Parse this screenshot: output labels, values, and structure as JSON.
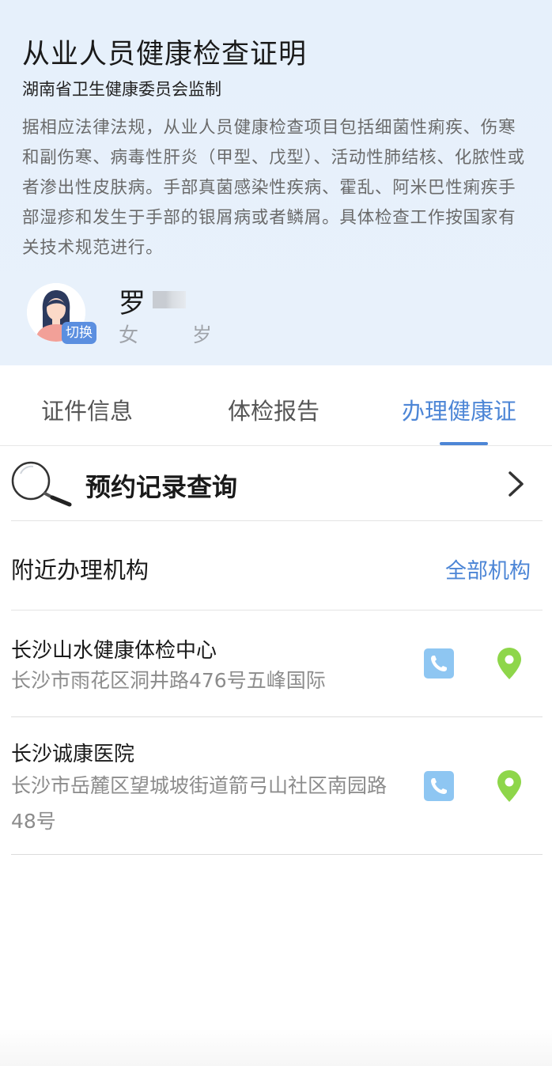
{
  "header": {
    "title": "从业人员健康检查证明",
    "supervisor": "湖南省卫生健康委员会监制",
    "description": "据相应法律法规，从业人员健康检查项目包括细菌性痢疾、伤寒和副伤寒、病毒性肝炎（甲型、戊型）、活动性肺结核、化脓性或者渗出性皮肤病。手部真菌感染性疾病、霍乱、阿米巴性痢疾手部湿疹和发生于手部的银屑病或者鳞屑。具体检查工作按国家有关技术规范进行。"
  },
  "user": {
    "name": "罗",
    "gender": "女",
    "age_unit": "岁",
    "switch_label": "切换"
  },
  "tabs": [
    {
      "label": "证件信息",
      "active": false
    },
    {
      "label": "体检报告",
      "active": false
    },
    {
      "label": "办理健康证",
      "active": true
    }
  ],
  "query": {
    "label": "预约记录查询",
    "icon": "magnifier-icon"
  },
  "nearby": {
    "title": "附近办理机构",
    "all_link": "全部机构"
  },
  "organizations": [
    {
      "name": "长沙山水健康体检中心",
      "address": "长沙市雨花区洞井路476号五峰国际"
    },
    {
      "name": "长沙诚康医院",
      "address": "长沙市岳麓区望城坡街道箭弓山社区南园路48号"
    }
  ],
  "colors": {
    "accent": "#4d86d6",
    "phone": "#8ec6f2",
    "location": "#8ed64a",
    "header_bg": "#e6f0fb"
  }
}
